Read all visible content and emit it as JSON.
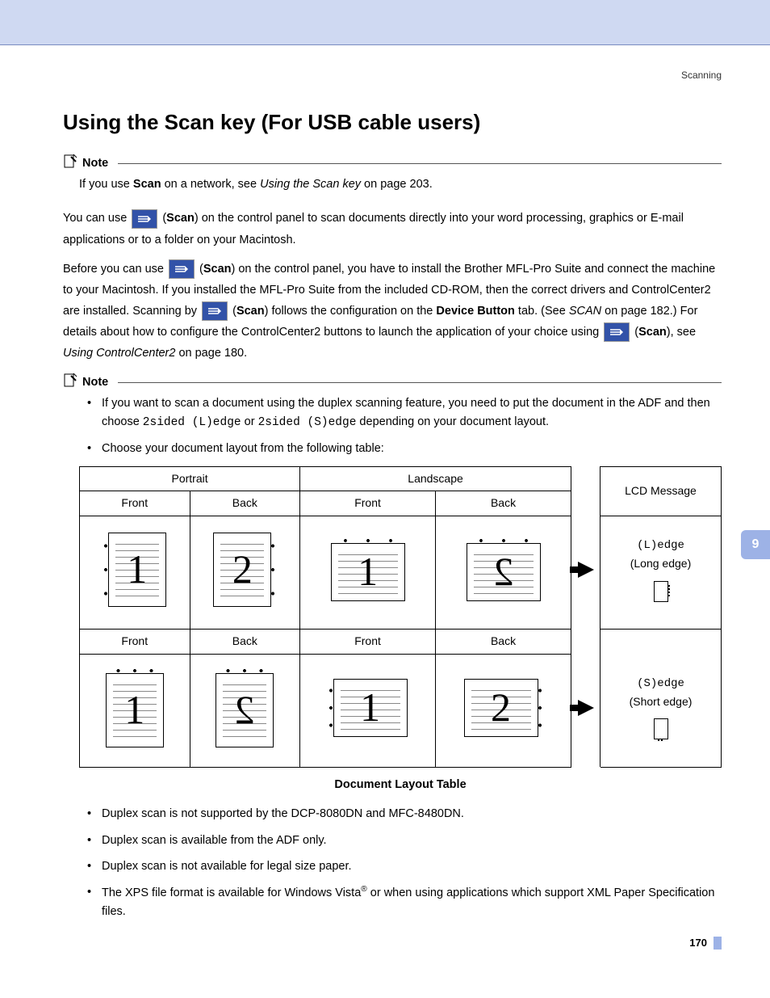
{
  "breadcrumb": "Scanning",
  "heading": "Using the Scan key (For USB cable users)",
  "note_label": "Note",
  "note1": {
    "pre": "If you use ",
    "scan_bold": "Scan",
    "mid": " on a network, see ",
    "link_italic": "Using the Scan key",
    "post": " on page 203."
  },
  "para1": {
    "pre": "You can use ",
    "scan_paren": "Scan",
    "post": ") on the control panel to scan documents directly into your word processing, graphics or E-mail applications or to a folder on your Macintosh."
  },
  "para2": {
    "pre": "Before you can use ",
    "scan_paren": "Scan",
    "mid1": ") on the control panel, you have to install the Brother MFL-Pro Suite and connect the machine to your Macintosh. If you installed the MFL-Pro Suite from the included CD-ROM, then the correct drivers and ControlCenter2 are installed. Scanning by ",
    "mid2": ") follows the configuration on the ",
    "device_button": "Device Button",
    "mid3": " tab. (See ",
    "scan_link_italic": "SCAN",
    "mid4": " on page 182.) For details about how to configure the ControlCenter2 buttons to launch the application of your choice using ",
    "mid5": "), see ",
    "cc2_link_italic": "Using ControlCenter2",
    "post": " on page 180."
  },
  "note2_bullets": {
    "b1_pre": "If you want to scan a document using the duplex scanning feature, you need to put the document in the ADF and then choose ",
    "b1_mono1": "2sided (L)edge",
    "b1_mid": " or ",
    "b1_mono2": "2sided (S)edge",
    "b1_post": " depending on your document layout.",
    "b2": "Choose your document layout from the following table:"
  },
  "table": {
    "h_portrait": "Portrait",
    "h_landscape": "Landscape",
    "h_lcd": "LCD Message",
    "h_front": "Front",
    "h_back": "Back",
    "msg_l_mono": "(L)edge",
    "msg_l_sub": "(Long edge)",
    "msg_s_mono": "(S)edge",
    "msg_s_sub": "(Short edge)",
    "n1": "1",
    "n2": "2"
  },
  "table_caption": "Document Layout Table",
  "bottom_bullets": {
    "b1": "Duplex scan is not supported by the DCP-8080DN and MFC-8480DN.",
    "b2": "Duplex scan is available from the ADF only.",
    "b3": "Duplex scan is not available for legal size paper.",
    "b4_pre": "The XPS file format is available for Windows Vista",
    "b4_sup": "®",
    "b4_post": " or when using applications which support XML Paper Specification files."
  },
  "side_tab": "9",
  "page_number": "170"
}
